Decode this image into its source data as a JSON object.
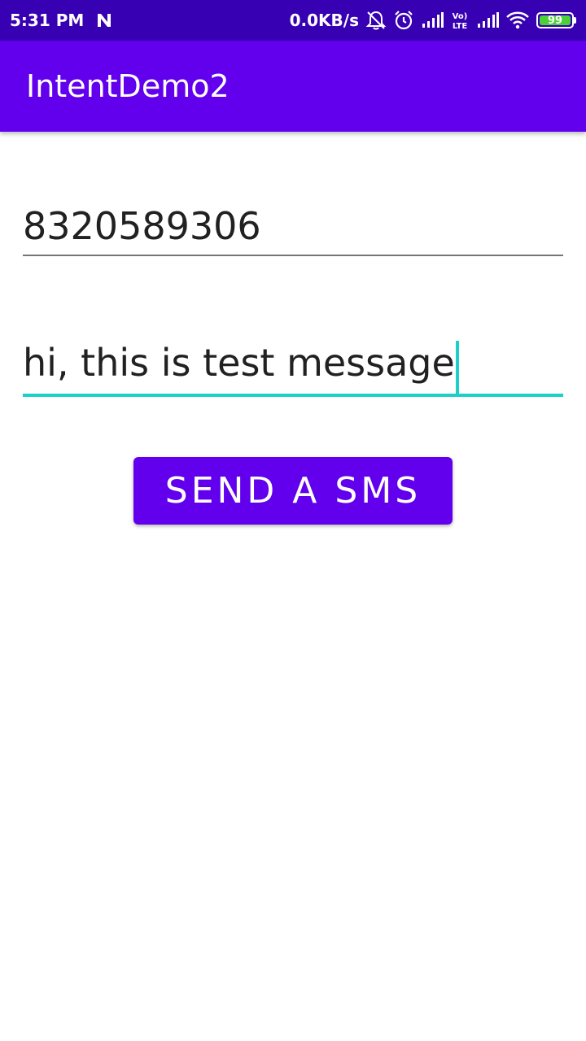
{
  "status_bar": {
    "time": "5:31 PM",
    "network_speed": "0.0KB/s",
    "battery_level": "99",
    "icons": [
      "app-n-icon",
      "mute-bell-icon",
      "alarm-icon",
      "signal-icon",
      "volte-icon",
      "signal-icon",
      "wifi-icon",
      "battery-icon"
    ]
  },
  "app_bar": {
    "title": "IntentDemo2"
  },
  "form": {
    "phone_value": "8320589306",
    "message_value": "hi, this is test message",
    "send_button_label": "SEND A SMS"
  },
  "colors": {
    "status_bar": "#3700B3",
    "primary": "#6200EE",
    "accent": "#1CCFC9"
  }
}
